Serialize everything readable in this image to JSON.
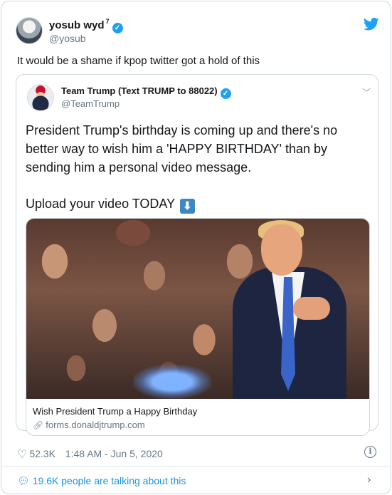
{
  "author": {
    "display_name": "yosub wyd",
    "badge": "7",
    "handle": "@yosub",
    "avatar_icon": "user-avatar"
  },
  "tweet_text": "It would be a shame if kpop twitter got a hold of this",
  "quoted": {
    "display_name": "Team Trump (Text TRUMP to 88022)",
    "handle": "@TeamTrump",
    "body": "President Trump's birthday is coming up and there's no better way to wish him a 'HAPPY BIRTHDAY' than by sending him a personal video message.",
    "upload_line": "Upload your video TODAY",
    "link_card": {
      "title": "Wish President Trump a Happy Birthday",
      "domain": "forms.donaldjtrump.com"
    }
  },
  "meta": {
    "likes": "52.3K",
    "timestamp": "1:48 AM - Jun 5, 2020"
  },
  "footer": {
    "talking": "19.6K people are talking about this"
  },
  "colors": {
    "accent": "#1da1f2",
    "link": "#1b95e0",
    "muted": "#657786"
  }
}
